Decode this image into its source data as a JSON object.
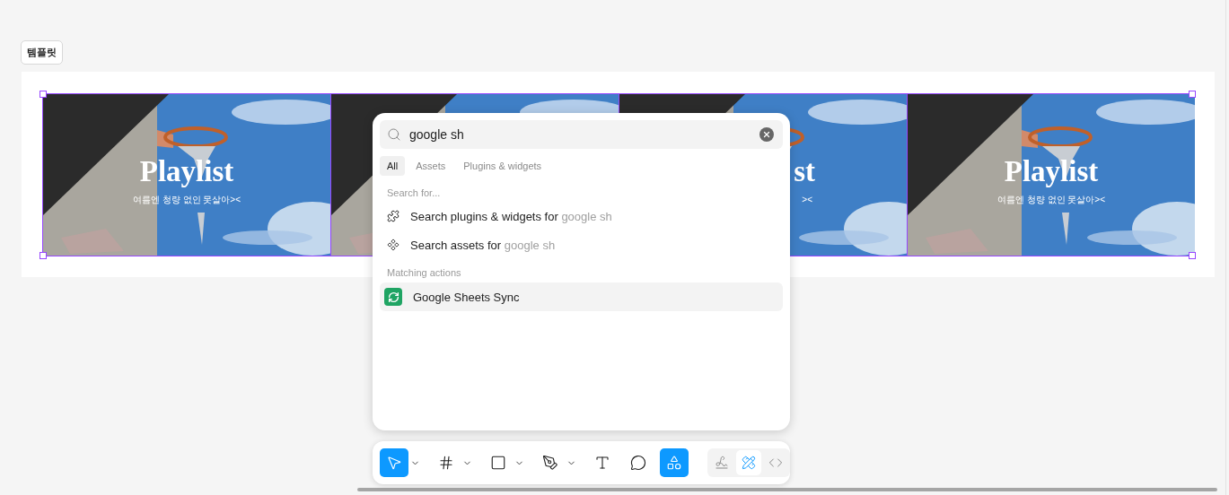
{
  "template_label": "템플릿",
  "cards": [
    {
      "kind": "picture",
      "title": "Playlist",
      "subtitle": "여름엔 청량 없인 못살아><",
      "cut": false
    },
    {
      "kind": "picture"
    },
    {
      "kind": "picture",
      "title": "st",
      "subtitle": "><",
      "cut": true
    },
    {
      "kind": "picture",
      "title": "Playlist",
      "subtitle": "여름엔 청량 없인 못살아><",
      "cut": false
    }
  ],
  "search": {
    "value": "google sh"
  },
  "tabs": [
    {
      "label": "All",
      "selected": true
    },
    {
      "label": "Assets",
      "selected": false
    },
    {
      "label": "Plugins & widgets",
      "selected": false
    }
  ],
  "search_for": {
    "heading": "Search for...",
    "items": [
      {
        "kind": "plugins",
        "text": "Search plugins & widgets for",
        "query": "google sh"
      },
      {
        "kind": "assets",
        "text": "Search assets for",
        "query": "google sh"
      }
    ]
  },
  "matching_actions": {
    "heading": "Matching actions",
    "items": [
      {
        "kind": "sync",
        "label": "Google Sheets Sync",
        "selected": true
      }
    ]
  },
  "toolbar": {
    "tools": [
      {
        "kind": "move",
        "selected": true,
        "caret": true
      },
      {
        "kind": "frame",
        "selected": false,
        "caret": true
      },
      {
        "kind": "rectangle",
        "selected": false,
        "caret": true
      },
      {
        "kind": "pen",
        "selected": false,
        "caret": true
      },
      {
        "kind": "text",
        "selected": false,
        "caret": false
      },
      {
        "kind": "comment",
        "selected": false,
        "caret": false
      },
      {
        "kind": "actions",
        "selected": true,
        "caret": false
      }
    ],
    "modes": [
      {
        "kind": "draw",
        "selected": false
      },
      {
        "kind": "design",
        "selected": true
      },
      {
        "kind": "dev",
        "selected": false
      }
    ]
  }
}
